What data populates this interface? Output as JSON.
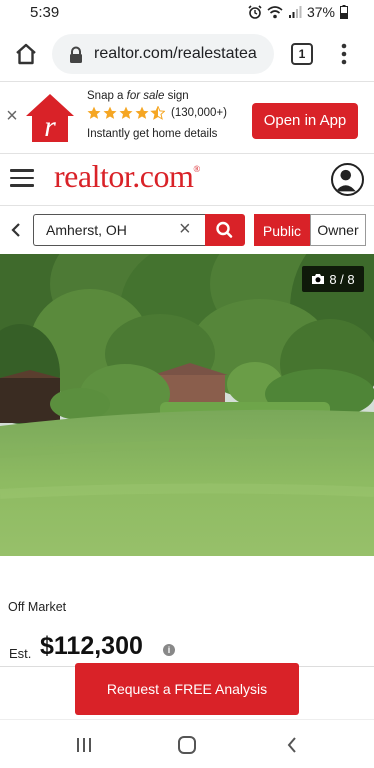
{
  "status_bar": {
    "time": "5:39",
    "battery": "37%"
  },
  "browser": {
    "url": "realtor.com/realestatea",
    "tab_count": "1"
  },
  "app_banner": {
    "snap_prefix": "Snap a ",
    "snap_emphasis": "for sale",
    "snap_suffix": " sign",
    "rating_count": "(130,000+)",
    "stars": 4.5,
    "tagline": "Instantly get home details",
    "open_button": "Open in App"
  },
  "header": {
    "brand": "realtor.com",
    "brand_mark": "®"
  },
  "search": {
    "value": "Amherst, OH",
    "toggle_public": "Public",
    "toggle_owner": "Owner"
  },
  "photo": {
    "counter": "8 / 8"
  },
  "listing": {
    "status": "Off Market",
    "est_label": "Est.",
    "price": "$112,300"
  },
  "cta": {
    "label": "Request a FREE Analysis"
  },
  "colors": {
    "brand_red": "#d92228",
    "star_gold": "#f5a623"
  }
}
